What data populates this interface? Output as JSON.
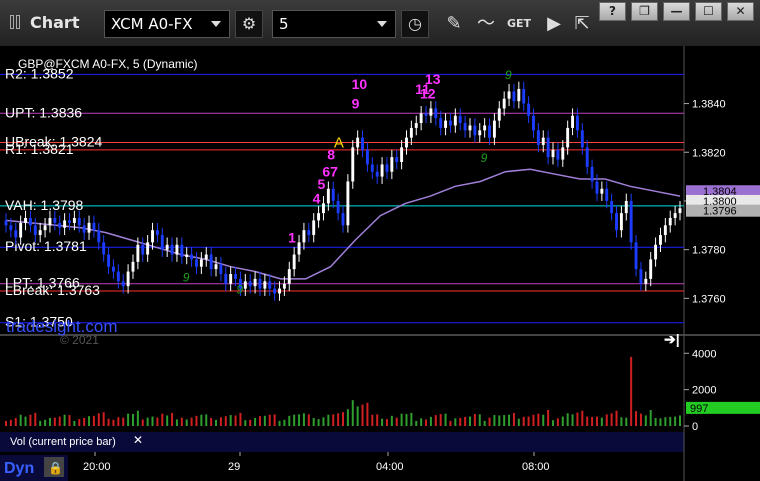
{
  "window": {
    "title": "Chart",
    "symbol": "XCM A0-FX",
    "interval": "5",
    "icons": [
      "gear-icon",
      "clock-icon",
      "pencil-icon",
      "indicator-icon",
      "get-icon",
      "play-icon",
      "export-icon"
    ],
    "win_buttons": [
      "?",
      "❐",
      "—",
      "☐",
      "✕"
    ]
  },
  "chart_title": "GBP@FXCM A0-FX, 5 (Dynamic)",
  "watermark": "tradesight.com",
  "copyright": "© 2021",
  "colors": {
    "background": "#000000",
    "panel_bg": "#0b0b2a",
    "axis_bg": "#000000",
    "up_candle": "#ffffff",
    "down_candle": "#1c3cff",
    "vwap_line": "#a080d8",
    "level_magenta": "#c040c0",
    "level_cyan": "#00e0e0",
    "level_blue": "#2020ff",
    "level_red": "#ff3030"
  },
  "levels": [
    {
      "name": "R2",
      "label": "R2: 1.3852",
      "value": 1.3852,
      "color": "#2020ff"
    },
    {
      "name": "UPT",
      "label": "UPT: 1.3836",
      "value": 1.3836,
      "color": "#c040c0"
    },
    {
      "name": "UBreak",
      "label": "UBreak: 1.3824",
      "value": 1.3824,
      "color": "#ff4040"
    },
    {
      "name": "R1",
      "label": "R1: 1.3821",
      "value": 1.3821,
      "color": "#ff3030"
    },
    {
      "name": "VAH",
      "label": "VAH: 1.3798",
      "value": 1.3798,
      "color": "#00e0e0"
    },
    {
      "name": "Pivot",
      "label": "Pivot: 1.3781",
      "value": 1.3781,
      "color": "#2020ff"
    },
    {
      "name": "LPT",
      "label": "LPT: 1.3766",
      "value": 1.3766,
      "color": "#c040c0"
    },
    {
      "name": "LBreak",
      "label": "LBreak: 1.3763",
      "value": 1.3763,
      "color": "#ff3030"
    },
    {
      "name": "S1",
      "label": "S1: 1.3750",
      "value": 1.375,
      "color": "#2020ff"
    }
  ],
  "chart_data": {
    "type": "candlestick",
    "price_ticks": [
      "1.3840",
      "1.3820",
      "1.3800",
      "1.3780",
      "1.3760"
    ],
    "price_range": [
      1.3747,
      1.3862
    ],
    "price_badges": [
      {
        "text": "1.3804",
        "value": 1.3804,
        "color": "#9a70d0"
      },
      {
        "text": "1.3800",
        "value": 1.38,
        "color": "#e8e8e8"
      },
      {
        "text": "1.3796",
        "value": 1.3796,
        "color": "#b0b0b0"
      }
    ],
    "time_ticks": [
      "20:00",
      "29",
      "04:00",
      "08:00"
    ],
    "closes": [
      1.379,
      1.3788,
      1.3785,
      1.3791,
      1.3793,
      1.379,
      1.3786,
      1.3788,
      1.379,
      1.3793,
      1.3791,
      1.3789,
      1.3792,
      1.3791,
      1.3793,
      1.379,
      1.3787,
      1.3791,
      1.3788,
      1.3783,
      1.3778,
      1.3773,
      1.3771,
      1.3767,
      1.3765,
      1.3771,
      1.3775,
      1.3782,
      1.3778,
      1.3783,
      1.3788,
      1.3786,
      1.378,
      1.3782,
      1.3778,
      1.3782,
      1.3777,
      1.3778,
      1.3776,
      1.3773,
      1.3776,
      1.3778,
      1.3772,
      1.3774,
      1.377,
      1.3766,
      1.377,
      1.3768,
      1.3764,
      1.3767,
      1.3765,
      1.3768,
      1.3764,
      1.3767,
      1.3764,
      1.3762,
      1.3764,
      1.3766,
      1.3772,
      1.3778,
      1.3783,
      1.3788,
      1.3786,
      1.3792,
      1.3795,
      1.3799,
      1.3805,
      1.38,
      1.3795,
      1.379,
      1.3808,
      1.3822,
      1.3826,
      1.3821,
      1.3815,
      1.3812,
      1.381,
      1.3815,
      1.3812,
      1.3818,
      1.3816,
      1.3822,
      1.3826,
      1.383,
      1.3832,
      1.3836,
      1.3835,
      1.3838,
      1.3834,
      1.383,
      1.3833,
      1.3831,
      1.3835,
      1.3832,
      1.3829,
      1.3831,
      1.3827,
      1.3829,
      1.3831,
      1.3826,
      1.3833,
      1.3838,
      1.3842,
      1.3845,
      1.3841,
      1.3846,
      1.384,
      1.3835,
      1.3829,
      1.3823,
      1.3826,
      1.3818,
      1.3821,
      1.3817,
      1.3822,
      1.383,
      1.3835,
      1.3829,
      1.3822,
      1.3814,
      1.3808,
      1.3803,
      1.3805,
      1.38,
      1.3795,
      1.3788,
      1.3795,
      1.38,
      1.3783,
      1.3772,
      1.3766,
      1.3768,
      1.3776,
      1.3782,
      1.3786,
      1.379,
      1.3793,
      1.3795,
      1.3797
    ],
    "vwap": [
      1.3792,
      1.3791,
      1.379,
      1.3789,
      1.3787,
      1.3784,
      1.3781,
      1.3778,
      1.3776,
      1.3773,
      1.3771,
      1.3768,
      1.3768,
      1.3773,
      1.3784,
      1.3794,
      1.3799,
      1.3802,
      1.3806,
      1.3808,
      1.3812,
      1.3813,
      1.3811,
      1.3809,
      1.3809,
      1.3806,
      1.3804,
      1.3802
    ],
    "volume_ticks": [
      "4000",
      "2000",
      "0"
    ],
    "volume_range": [
      0,
      4400
    ],
    "volume_badge": "997",
    "volume_label": "Vol (current price bar)",
    "annotations_magenta": [
      {
        "text": "1",
        "i": 59,
        "price": 1.3783
      },
      {
        "text": "4",
        "i": 64,
        "price": 1.3799
      },
      {
        "text": "5",
        "i": 65,
        "price": 1.3805
      },
      {
        "text": "67",
        "i": 66,
        "price": 1.381
      },
      {
        "text": "8",
        "i": 67,
        "price": 1.3817
      },
      {
        "text": "10",
        "i": 72,
        "price": 1.3846
      },
      {
        "text": "9",
        "i": 72,
        "price": 1.3838
      },
      {
        "text": "11",
        "i": 85,
        "price": 1.3844
      },
      {
        "text": "12",
        "i": 86,
        "price": 1.3842
      },
      {
        "text": "13",
        "i": 87,
        "price": 1.3848
      }
    ],
    "annotations_green": [
      {
        "text": "9",
        "i": 98,
        "price": 1.3816
      },
      {
        "text": "9",
        "i": 103,
        "price": 1.385
      },
      {
        "text": "9",
        "i": 48,
        "price": 1.3762
      },
      {
        "text": "9",
        "i": 37,
        "price": 1.3767
      }
    ],
    "annotation_yellow": {
      "text": "A",
      "i": 70,
      "price": 1.3822
    }
  },
  "bottom_label": "Dyn"
}
